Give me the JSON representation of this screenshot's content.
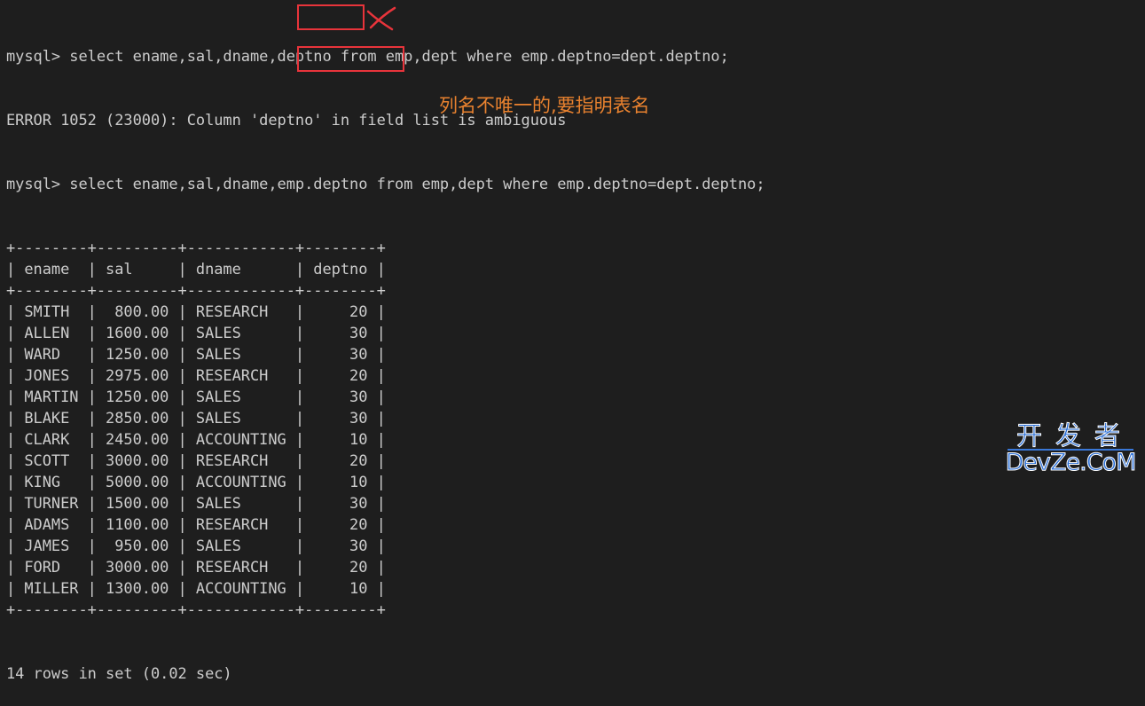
{
  "terminal": {
    "lines": [
      "mysql> select ename,sal,dname,deptno from emp,dept where emp.deptno=dept.deptno;",
      "ERROR 1052 (23000): Column 'deptno' in field list is ambiguous",
      "mysql> select ename,sal,dname,emp.deptno from emp,dept where emp.deptno=dept.deptno;"
    ],
    "table_border": "+--------+---------+------------+--------+",
    "columns": [
      "ename",
      "sal",
      "dname",
      "deptno"
    ],
    "header_line": "| ename  | sal     | dname      | deptno |",
    "rows": [
      [
        "SMITH",
        "800.00",
        "RESEARCH",
        "20"
      ],
      [
        "ALLEN",
        "1600.00",
        "SALES",
        "30"
      ],
      [
        "WARD",
        "1250.00",
        "SALES",
        "30"
      ],
      [
        "JONES",
        "2975.00",
        "RESEARCH",
        "20"
      ],
      [
        "MARTIN",
        "1250.00",
        "SALES",
        "30"
      ],
      [
        "BLAKE",
        "2850.00",
        "SALES",
        "30"
      ],
      [
        "CLARK",
        "2450.00",
        "ACCOUNTING",
        "10"
      ],
      [
        "SCOTT",
        "3000.00",
        "RESEARCH",
        "20"
      ],
      [
        "KING",
        "5000.00",
        "ACCOUNTING",
        "10"
      ],
      [
        "TURNER",
        "1500.00",
        "SALES",
        "30"
      ],
      [
        "ADAMS",
        "1100.00",
        "RESEARCH",
        "20"
      ],
      [
        "JAMES",
        "950.00",
        "SALES",
        "30"
      ],
      [
        "FORD",
        "3000.00",
        "RESEARCH",
        "20"
      ],
      [
        "MILLER",
        "1300.00",
        "ACCOUNTING",
        "10"
      ]
    ],
    "footer": "14 rows in set (0.02 sec)"
  },
  "annotation": {
    "note": "列名不唯一的,要指明表名",
    "note_color": "#e9822f",
    "highlight_color": "#e8343b",
    "error_mark_icon": "cross-mark-icon"
  },
  "watermark": {
    "cn": "开发者",
    "en": "DevZe.CoM",
    "color": "#2b6fd6"
  }
}
